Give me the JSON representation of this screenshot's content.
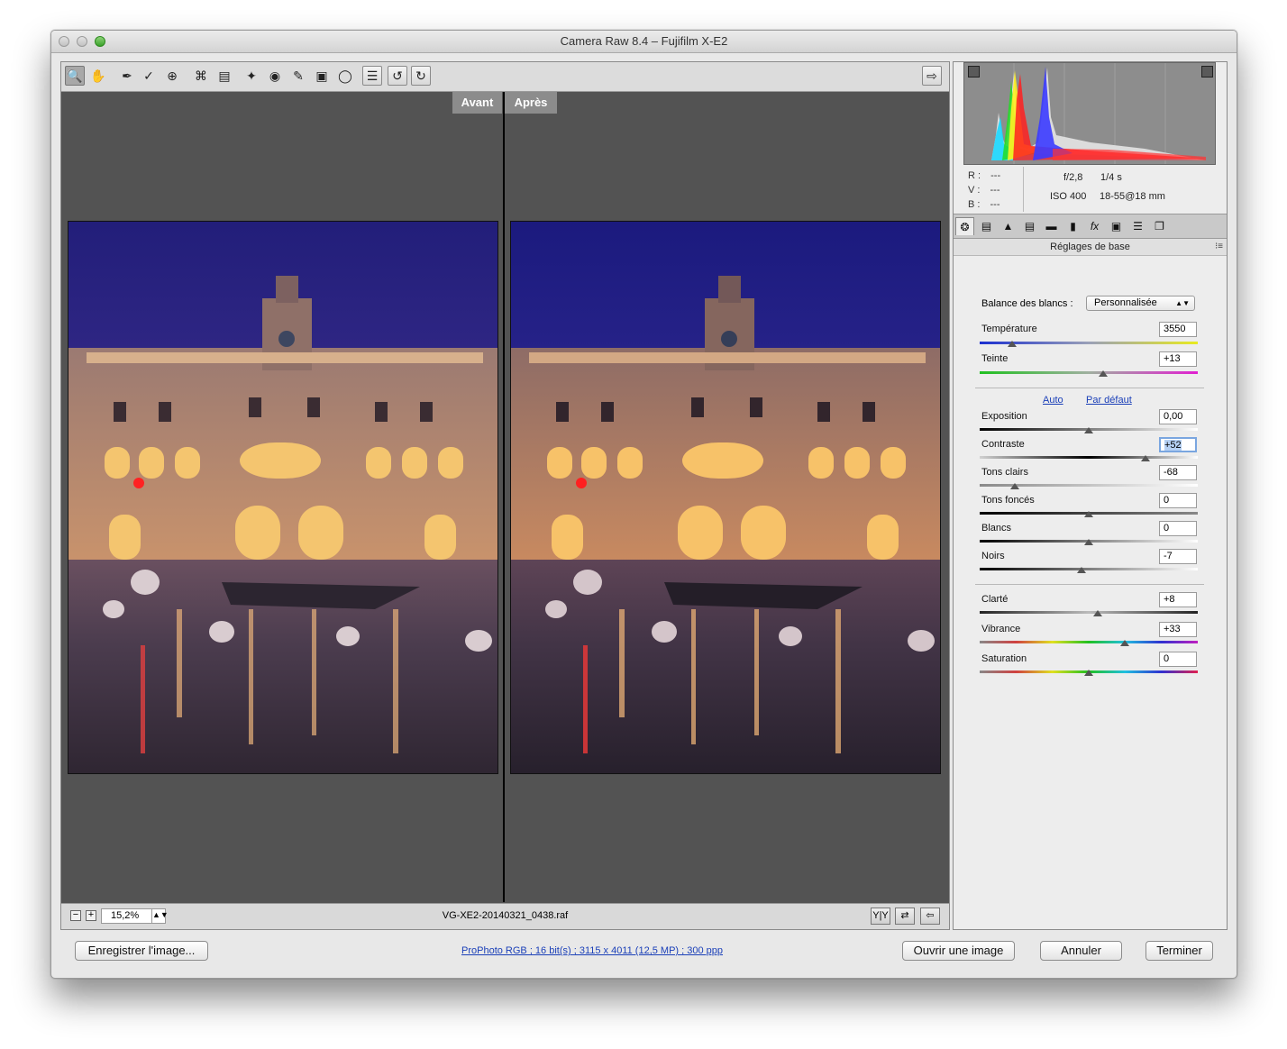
{
  "window": {
    "title": "Camera Raw 8.4  –  Fujifilm X-E2"
  },
  "toolbar": {
    "tools": [
      "zoom-icon",
      "hand-icon",
      "white-balance-icon",
      "color-sampler-icon",
      "targeted-adjust-icon",
      "crop-icon",
      "straighten-icon",
      "spot-removal-icon",
      "red-eye-icon",
      "adjustment-brush-icon",
      "graduated-filter-icon",
      "radial-filter-icon",
      "preferences-icon",
      "rotate-left-icon",
      "rotate-right-icon"
    ],
    "active_tool": "zoom-icon",
    "fullscreen_icon": "fullscreen-toggle-icon"
  },
  "preview": {
    "before_label": "Avant",
    "after_label": "Après"
  },
  "statusbar": {
    "zoom_out_label": "−",
    "zoom_in_label": "+",
    "zoom_value": "15,2%",
    "filename": "VG-XE2-20140321_0438.raf",
    "view_modes_label": "Y|Y",
    "swap_label": "⇄",
    "copy_label": "⇦"
  },
  "histogram": {
    "r_label": "R :",
    "r_value": "---",
    "v_label": "V :",
    "v_value": "---",
    "b_label": "B :",
    "b_value": "---",
    "aperture": "f/2,8",
    "shutter": "1/4 s",
    "iso": "ISO 400",
    "lens": "18-55@18 mm"
  },
  "panel_tabs": [
    "basic-icon",
    "tone-curve-icon",
    "detail-icon",
    "hsl-icon",
    "split-toning-icon",
    "lens-corrections-icon",
    "effects-icon",
    "camera-calibration-icon",
    "presets-icon",
    "snapshots-icon"
  ],
  "section": {
    "title": "Réglages de base",
    "menu_glyph": "⁝≡"
  },
  "white_balance": {
    "label": "Balance des blancs :",
    "value": "Personnalisée",
    "arrow": "▲▼"
  },
  "links": {
    "auto": "Auto",
    "default": "Par défaut"
  },
  "sliders": {
    "temperature": {
      "label": "Température",
      "value": "3550",
      "position": 0.15
    },
    "tint": {
      "label": "Teinte",
      "value": "+13",
      "position": 0.565
    },
    "exposure": {
      "label": "Exposition",
      "value": "0,00",
      "position": 0.5
    },
    "contrast": {
      "label": "Contraste",
      "value": "+52",
      "position": 0.76
    },
    "highlights": {
      "label": "Tons clairs",
      "value": "-68",
      "position": 0.16
    },
    "shadows": {
      "label": "Tons foncés",
      "value": "0",
      "position": 0.5
    },
    "whites": {
      "label": "Blancs",
      "value": "0",
      "position": 0.5
    },
    "blacks": {
      "label": "Noirs",
      "value": "-7",
      "position": 0.465
    },
    "clarity": {
      "label": "Clarté",
      "value": "+8",
      "position": 0.54
    },
    "vibrance": {
      "label": "Vibrance",
      "value": "+33",
      "position": 0.665
    },
    "saturation": {
      "label": "Saturation",
      "value": "0",
      "position": 0.5
    }
  },
  "footer": {
    "save_button": "Enregistrer l'image...",
    "workflow_info": "ProPhoto RGB ; 16 bit(s) ; 3115 x 4011 (12,5 MP) ; 300 ppp",
    "open_button": "Ouvrir une image",
    "cancel_button": "Annuler",
    "done_button": "Terminer"
  }
}
